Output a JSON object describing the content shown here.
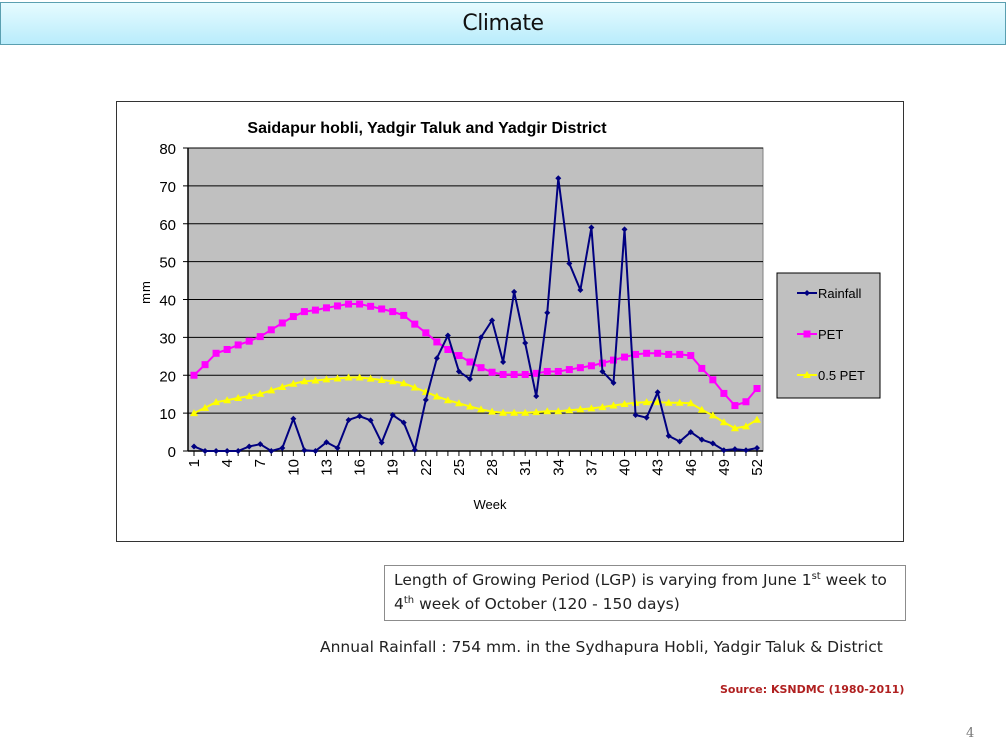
{
  "slide": {
    "title": "Climate",
    "lgp_text_part1": "Length of Growing Period (LGP) is varying from June 1",
    "lgp_sup1": "st",
    "lgp_text_part2": " week to 4",
    "lgp_sup2": "th",
    "lgp_text_part3": " week of October (120 - 150 days)",
    "annual_rainfall": "Annual Rainfall : 754 mm. in the Sydhapura Hobli, Yadgir Taluk & District",
    "source": "Source: KSNDMC (1980-2011)",
    "page_number": "4"
  },
  "chart_data": {
    "type": "line",
    "title": "Saidapur hobli, Yadgir Taluk and Yadgir District",
    "xlabel": "Week",
    "ylabel": "mm",
    "ylim": [
      0,
      80
    ],
    "yticks": [
      0,
      10,
      20,
      30,
      40,
      50,
      60,
      70,
      80
    ],
    "xtick_labels": [
      "1",
      "4",
      "7",
      "10",
      "13",
      "16",
      "19",
      "22",
      "25",
      "28",
      "31",
      "34",
      "37",
      "40",
      "43",
      "46",
      "49",
      "52"
    ],
    "grid": true,
    "legend_position": "right",
    "x": [
      1,
      2,
      3,
      4,
      5,
      6,
      7,
      8,
      9,
      10,
      11,
      12,
      13,
      14,
      15,
      16,
      17,
      18,
      19,
      20,
      21,
      22,
      23,
      24,
      25,
      26,
      27,
      28,
      29,
      30,
      31,
      32,
      33,
      34,
      35,
      36,
      37,
      38,
      39,
      40,
      41,
      42,
      43,
      44,
      45,
      46,
      47,
      48,
      49,
      50,
      51,
      52
    ],
    "series": [
      {
        "name": "Rainfall",
        "color": "#000080",
        "marker": "diamond",
        "values": [
          1.2,
          0,
          0,
          0,
          0,
          1.2,
          1.8,
          0,
          0.8,
          8.5,
          0.2,
          0,
          2.3,
          0.8,
          8.2,
          9.2,
          8.1,
          2.2,
          9.5,
          7.5,
          0.3,
          13.5,
          24.5,
          30.5,
          21,
          19,
          30,
          34.5,
          23.5,
          42,
          28.5,
          14.5,
          36.5,
          72,
          49.5,
          42.5,
          59,
          21,
          18,
          58.5,
          9.5,
          8.8,
          15.5,
          4,
          2.5,
          5,
          3,
          2,
          0.2,
          0.5,
          0.2,
          0.8
        ]
      },
      {
        "name": "PET",
        "color": "#ff00ff",
        "marker": "square",
        "values": [
          20,
          22.8,
          25.8,
          26.8,
          28,
          29,
          30.2,
          32,
          33.8,
          35.5,
          36.8,
          37.2,
          37.8,
          38.3,
          38.8,
          38.8,
          38.2,
          37.5,
          36.8,
          35.8,
          33.5,
          31.2,
          28.8,
          26.8,
          25.2,
          23.5,
          22,
          20.8,
          20.2,
          20.2,
          20.2,
          20.5,
          21,
          21,
          21.5,
          22,
          22.5,
          23.2,
          24,
          24.8,
          25.5,
          25.8,
          25.8,
          25.5,
          25.5,
          25.2,
          21.8,
          18.8,
          15.2,
          12,
          13,
          16.5
        ]
      },
      {
        "name": "0.5 PET",
        "color": "#ffff00",
        "marker": "triangle",
        "values": [
          10,
          11.4,
          12.9,
          13.4,
          14,
          14.5,
          15.1,
          16,
          16.9,
          17.75,
          18.4,
          18.6,
          18.9,
          19.15,
          19.4,
          19.4,
          19.1,
          18.75,
          18.4,
          17.9,
          16.75,
          15.6,
          14.4,
          13.4,
          12.6,
          11.75,
          11,
          10.4,
          10.1,
          10.1,
          10.1,
          10.25,
          10.5,
          10.5,
          10.75,
          11,
          11.25,
          11.6,
          12,
          12.4,
          12.75,
          12.9,
          12.9,
          12.75,
          12.75,
          12.6,
          10.9,
          9.4,
          7.6,
          6,
          6.5,
          8.25
        ]
      }
    ]
  }
}
